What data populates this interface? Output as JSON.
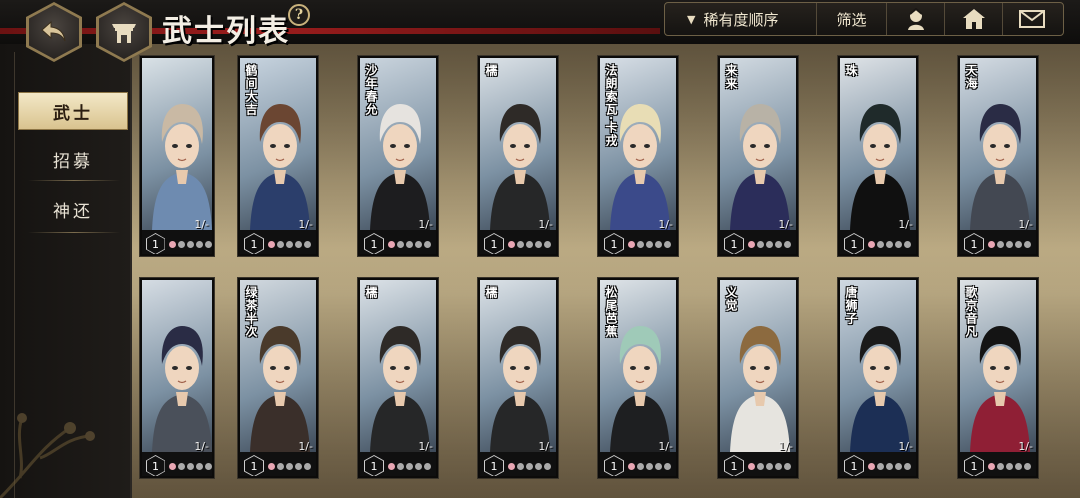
{
  "header": {
    "title": "武士列表",
    "help_icon": "?",
    "back_icon": "back-arrow-icon",
    "home_icon": "castle-gate-icon",
    "sort_label": "稀有度顺序",
    "filter_label": "筛选",
    "tool_icons": [
      "character-icon",
      "home-icon",
      "mail-icon"
    ]
  },
  "sidebar": {
    "items": [
      {
        "label": "武士"
      },
      {
        "label": "招募"
      },
      {
        "label": "神还"
      }
    ]
  },
  "cards": [
    {
      "name": "",
      "level": "1",
      "count": "1/-",
      "palette": [
        "#d9e1e6",
        "#6e8bb0",
        "#c9b9a4"
      ]
    },
    {
      "name": "鹤间大吉",
      "level": "1",
      "count": "1/-",
      "palette": [
        "#c8d4df",
        "#2b3e6b",
        "#6b4632"
      ]
    },
    {
      "name": "沙年春允",
      "level": "1",
      "count": "1/-",
      "palette": [
        "#cbd5de",
        "#1d1d1f",
        "#e6e3df"
      ]
    },
    {
      "name": "檽",
      "level": "1",
      "count": "1/-",
      "palette": [
        "#dce2e7",
        "#262728",
        "#2e2a27"
      ]
    },
    {
      "name": "法朗索瓦·卡戎",
      "level": "1",
      "count": "1/-",
      "palette": [
        "#d8dfe6",
        "#3b4a8a",
        "#e8ddb5"
      ]
    },
    {
      "name": "来来",
      "level": "1",
      "count": "1/-",
      "palette": [
        "#d3dbe2",
        "#2b2d5a",
        "#b8b2a6"
      ]
    },
    {
      "name": "珠",
      "level": "1",
      "count": "1/-",
      "palette": [
        "#dfe3e7",
        "#101010",
        "#1f2a2a"
      ]
    },
    {
      "name": "天海",
      "level": "1",
      "count": "1/-",
      "palette": [
        "#d5dce3",
        "#434852",
        "#2a2c45"
      ]
    },
    {
      "name": "",
      "level": "1",
      "count": "1/-",
      "palette": [
        "#d5dce3",
        "#4a505a",
        "#2a2c45"
      ]
    },
    {
      "name": "绿茶半次",
      "level": "1",
      "count": "1/-",
      "palette": [
        "#d2d9df",
        "#3a2f2a",
        "#4a3a2b"
      ]
    },
    {
      "name": "檽",
      "level": "1",
      "count": "1/-",
      "palette": [
        "#dce2e7",
        "#262728",
        "#2e2a27"
      ]
    },
    {
      "name": "檽",
      "level": "1",
      "count": "1/-",
      "palette": [
        "#dce2e7",
        "#262728",
        "#2e2a27"
      ]
    },
    {
      "name": "松尾芭蕉",
      "level": "1",
      "count": "1/-",
      "palette": [
        "#dfe4e8",
        "#1e1f21",
        "#9fcab8"
      ]
    },
    {
      "name": "义觉",
      "level": "1",
      "count": "1/-",
      "palette": [
        "#d5dce2",
        "#e6e4df",
        "#8c6a3f"
      ]
    },
    {
      "name": "唐狮子",
      "level": "1",
      "count": "1/-",
      "palette": [
        "#cfd8e1",
        "#1c2f55",
        "#1a1a1a"
      ]
    },
    {
      "name": "歌京音凡",
      "level": "1",
      "count": "1/-",
      "palette": [
        "#dde1e4",
        "#8f1f35",
        "#141414"
      ]
    }
  ],
  "petal_states": [
    true,
    false,
    false,
    false,
    false
  ],
  "colors": {
    "accent_gold": "#d9c38f",
    "red_band": "#9b1d1d",
    "petal_pink": "#e9a7b4"
  }
}
